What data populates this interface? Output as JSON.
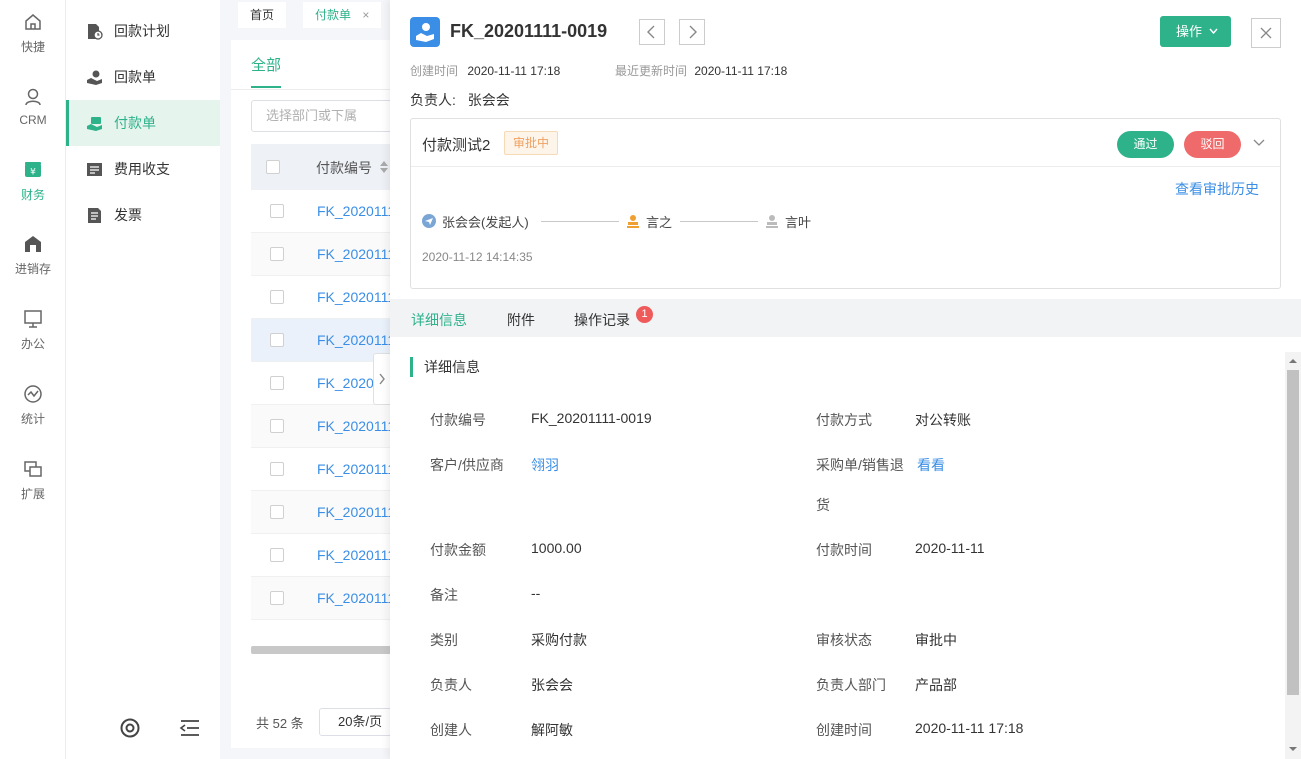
{
  "rail": {
    "items": [
      {
        "label": "快捷",
        "icon": "home-icon"
      },
      {
        "label": "CRM",
        "icon": "person-icon"
      },
      {
        "label": "财务",
        "icon": "finance-icon"
      },
      {
        "label": "进销存",
        "icon": "warehouse-icon"
      },
      {
        "label": "办公",
        "icon": "monitor-icon"
      },
      {
        "label": "统计",
        "icon": "stats-icon"
      },
      {
        "label": "扩展",
        "icon": "extension-icon"
      }
    ],
    "active_index": 2
  },
  "submenu": {
    "items": [
      {
        "label": "回款计划",
        "icon": "document-clock-icon"
      },
      {
        "label": "回款单",
        "icon": "hand-receive-icon"
      },
      {
        "label": "付款单",
        "icon": "hand-pay-icon"
      },
      {
        "label": "费用收支",
        "icon": "ledger-icon"
      },
      {
        "label": "发票",
        "icon": "invoice-icon"
      }
    ],
    "active_index": 2
  },
  "tabs": {
    "home": "首页",
    "current": "付款单",
    "close_glyph": "×"
  },
  "list": {
    "tab_all": "全部",
    "dept_placeholder": "选择部门或下属",
    "column_no": "付款编号",
    "rows": [
      "FK_2020111",
      "FK_2020111",
      "FK_2020111",
      "FK_2020111",
      "FK_2020",
      "FK_2020111",
      "FK_2020111",
      "FK_2020111",
      "FK_2020111",
      "FK_2020111"
    ],
    "total": "共 52 条",
    "page_size": "20条/页"
  },
  "detail": {
    "title": "FK_20201111-0019",
    "op_button": "操作",
    "created_label": "创建时间",
    "created_value": "2020-11-11 17:18",
    "updated_label": "最近更新时间",
    "updated_value": "2020-11-11 17:18",
    "owner_label": "负责人:",
    "owner_value": "张会会",
    "approval": {
      "name": "付款测试2",
      "status": "审批中",
      "pass": "通过",
      "reject": "驳回",
      "history": "查看审批历史",
      "flow": [
        "张会会(发起人)",
        "言之",
        "言叶"
      ],
      "time": "2020-11-12 14:14:35"
    },
    "tabs": {
      "info": "详细信息",
      "attach": "附件",
      "log": "操作记录",
      "log_badge": "1"
    },
    "section_title": "详细信息",
    "fields": {
      "pay_no_label": "付款编号",
      "pay_no": "FK_20201111-0019",
      "pay_method_label": "付款方式",
      "pay_method": "对公转账",
      "customer_label": "客户/供应商",
      "customer": "翎羽",
      "purchase_label_1": "采购单/销售退",
      "purchase_label_2": "货",
      "purchase": "看看",
      "amount_label": "付款金额",
      "amount": "1000.00",
      "pay_time_label": "付款时间",
      "pay_time": "2020-11-11",
      "remark_label": "备注",
      "remark": "--",
      "category_label": "类别",
      "category": "采购付款",
      "audit_label": "审核状态",
      "audit": "审批中",
      "owner_label": "负责人",
      "owner": "张会会",
      "dept_label": "负责人部门",
      "dept": "产品部",
      "creator_label": "创建人",
      "creator": "解阿敏",
      "create_time_label": "创建时间",
      "create_time": "2020-11-11 17:18"
    }
  },
  "colors": {
    "accent": "#2eb28a",
    "link": "#3a8ee6",
    "danger": "#ef6a6a",
    "warning": "#f0a060"
  }
}
